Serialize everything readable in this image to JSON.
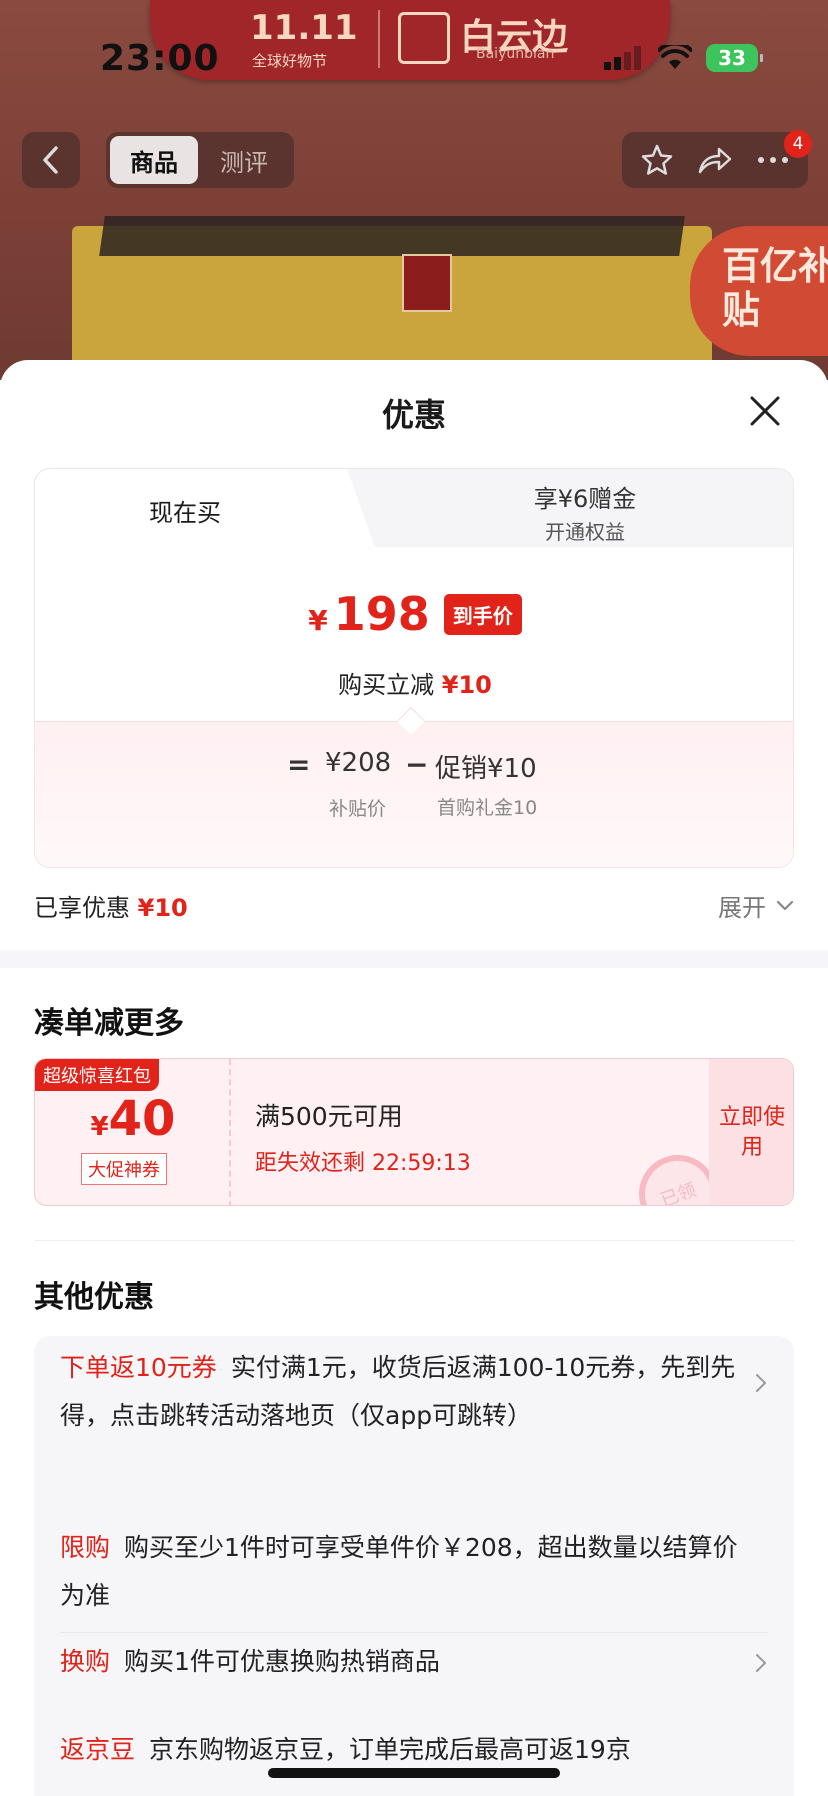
{
  "status_bar": {
    "time": "23:00",
    "battery": "33"
  },
  "background": {
    "banner_event": "11.11",
    "banner_event_sub": "全球好物节",
    "banner_brand": "白云边",
    "banner_brand_en": "Baiyunbian",
    "tabs": [
      "商品",
      "测评"
    ],
    "cart_badge": "4",
    "subsidy_badge": "百亿补贴"
  },
  "sheet": {
    "title": "优惠",
    "tabs": {
      "buy_now": "现在买",
      "bonus_title": "享¥6赠金",
      "bonus_sub": "开通权益"
    },
    "price": {
      "currency": "¥",
      "amount": "198",
      "tag": "到手价"
    },
    "reduce": {
      "label": "购买立减",
      "value": "¥10"
    },
    "calc": {
      "eq": "=",
      "base_value": "¥208",
      "base_label": "补贴价",
      "minus": "−",
      "promo_value": "促销¥10",
      "promo_label": "首购礼金10"
    },
    "enjoyed": {
      "label": "已享优惠",
      "value": "¥10"
    },
    "expand": "展开"
  },
  "more_section": {
    "title": "凑单减更多",
    "coupon": {
      "badge": "超级惊喜红包",
      "currency": "¥",
      "amount": "40",
      "type": "大促神券",
      "condition": "满500元可用",
      "expiry": "距失效还剩 22:59:13",
      "use_button": "立即使用",
      "stamp": "已领"
    }
  },
  "other_section": {
    "title": "其他优惠",
    "items": [
      {
        "tag": "下单返10元券",
        "text": "实付满1元，收货后返满100-10元券，先到先得，点击跳转活动落地页（仅app可跳转）"
      },
      {
        "tag": "限购",
        "text": "购买至少1件时可享受单件价￥208，超出数量以结算价为准"
      },
      {
        "tag": "换购",
        "text": "购买1件可优惠换购热销商品"
      },
      {
        "tag": "返京豆",
        "text": "京东购物返京豆，订单完成后最高可返19京"
      }
    ]
  }
}
